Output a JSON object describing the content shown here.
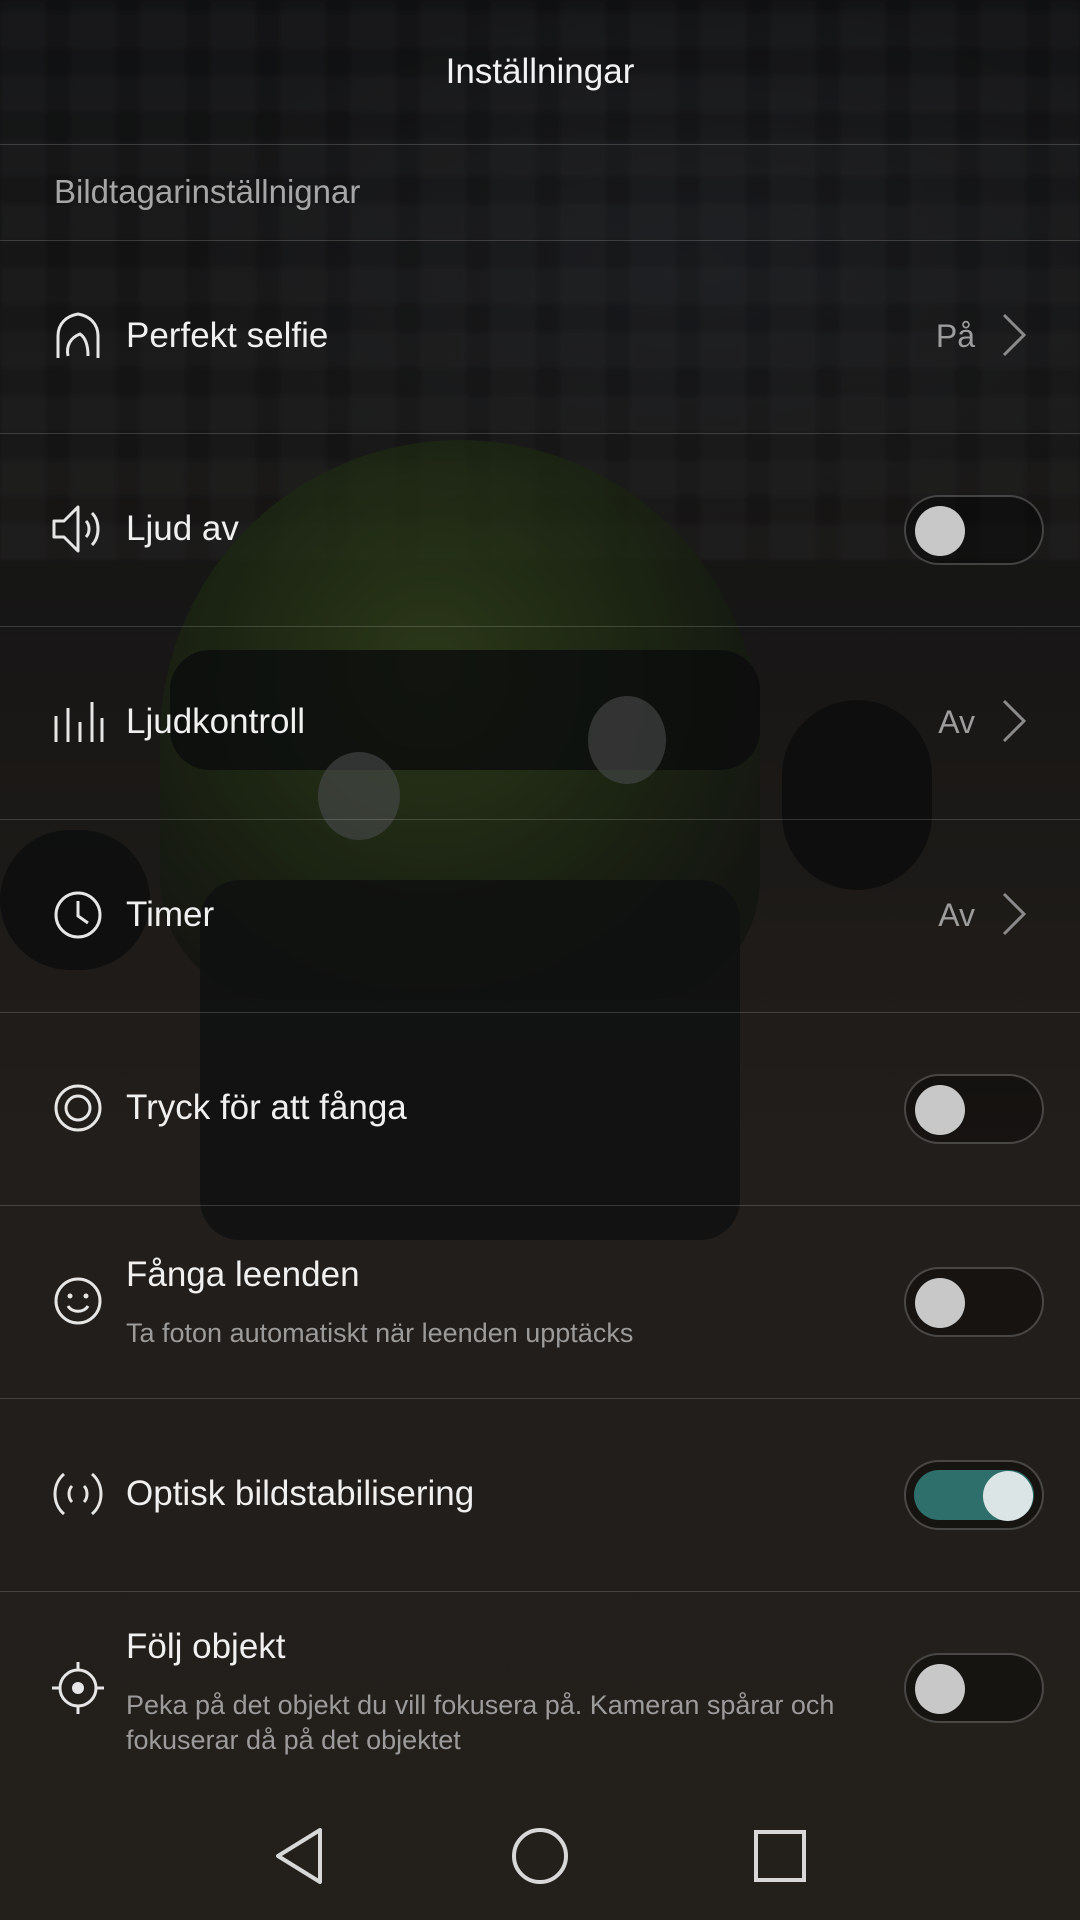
{
  "header": {
    "title": "Inställningar"
  },
  "section": {
    "title": "Bildtagarinställnignar"
  },
  "rows": [
    {
      "icon": "selfie-face-icon",
      "label": "Perfekt selfie",
      "type": "nav",
      "value": "På"
    },
    {
      "icon": "speaker-icon",
      "label": "Ljud av",
      "type": "toggle",
      "on": false
    },
    {
      "icon": "sound-bars-icon",
      "label": "Ljudkontroll",
      "type": "nav",
      "value": "Av"
    },
    {
      "icon": "clock-icon",
      "label": "Timer",
      "type": "nav",
      "value": "Av"
    },
    {
      "icon": "capture-target-icon",
      "label": "Tryck för att fånga",
      "type": "toggle",
      "on": false
    },
    {
      "icon": "smile-icon",
      "label": "Fånga leenden",
      "subtitle": "Ta foton automatiskt när leenden upptäcks",
      "type": "toggle",
      "on": false
    },
    {
      "icon": "stabilization-icon",
      "label": "Optisk bildstabilisering",
      "type": "toggle",
      "on": true
    },
    {
      "icon": "tracking-crosshair-icon",
      "label": "Följ objekt",
      "subtitle": "Peka på det objekt du vill fokusera på. Kameran spårar och fokuserar då på det objektet",
      "type": "toggle",
      "on": false
    }
  ],
  "colors": {
    "toggle_on": "#2f6f6b",
    "text_primary": "#f0f0f0",
    "text_secondary": "#9b9b9b"
  },
  "navbar": {
    "buttons": [
      "back-icon",
      "home-icon",
      "recents-icon"
    ]
  }
}
